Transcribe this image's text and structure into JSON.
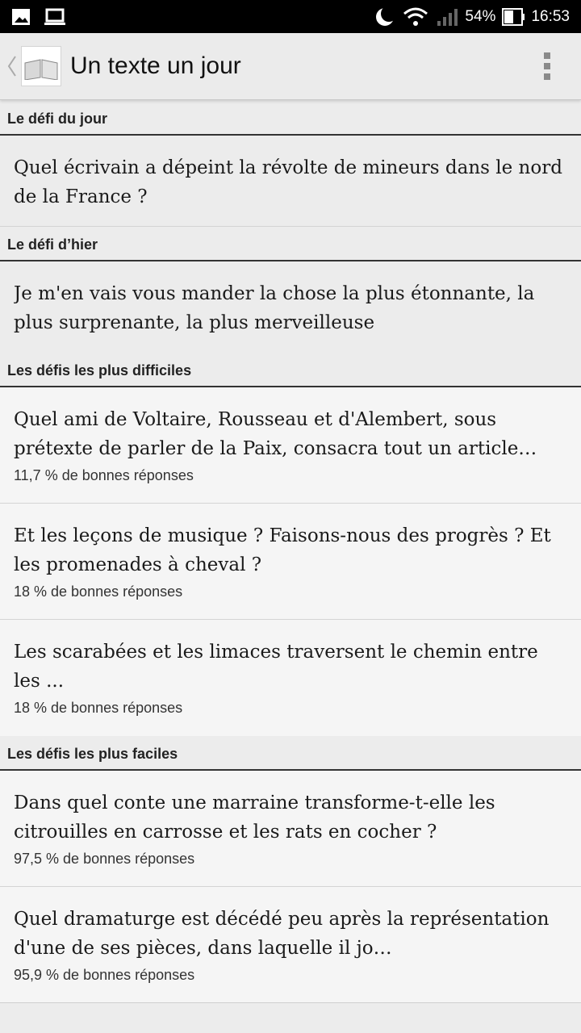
{
  "status_bar": {
    "battery_percent": "54%",
    "time": "16:53",
    "icons": [
      "image-icon",
      "laptop-icon",
      "moon-icon",
      "wifi-icon",
      "signal-icon",
      "battery-icon"
    ]
  },
  "app_bar": {
    "title": "Un texte un jour",
    "icons": [
      "back-chevron-icon",
      "book-logo-icon",
      "overflow-menu-icon"
    ]
  },
  "sections": {
    "today": {
      "header": "Le défi du jour",
      "item": {
        "question": "Quel écrivain a dépeint la révolte de mineurs dans le nord de la France ?"
      }
    },
    "yesterday": {
      "header": "Le défi d’hier",
      "item": {
        "question": "Je m'en vais vous mander la chose la plus étonnante, la plus surprenante, la plus merveilleuse"
      }
    },
    "hardest": {
      "header": "Les défis les plus difficiles",
      "items": [
        {
          "question": "Quel ami de Voltaire, Rousseau et d'Alembert, sous prétexte de parler de la Paix, consacra tout un article…",
          "stat": "11,7 % de bonnes réponses"
        },
        {
          "question": "Et les leçons de musique ? Faisons-nous des progrès ? Et les promenades à cheval ?",
          "stat": "18 % de bonnes réponses"
        },
        {
          "question": "Les scarabées et les limaces traversent le chemin entre les ...",
          "stat": "18 % de bonnes réponses"
        }
      ]
    },
    "easiest": {
      "header": "Les défis les plus faciles",
      "items": [
        {
          "question": "Dans quel conte une marraine transforme-t-elle les citrouilles en carrosse et les rats en cocher ?",
          "stat": "97,5 % de bonnes réponses"
        },
        {
          "question": "Quel dramaturge est décédé peu après la représentation d'une de ses pièces, dans laquelle il jo…",
          "stat": "95,9 % de bonnes réponses"
        }
      ]
    }
  }
}
